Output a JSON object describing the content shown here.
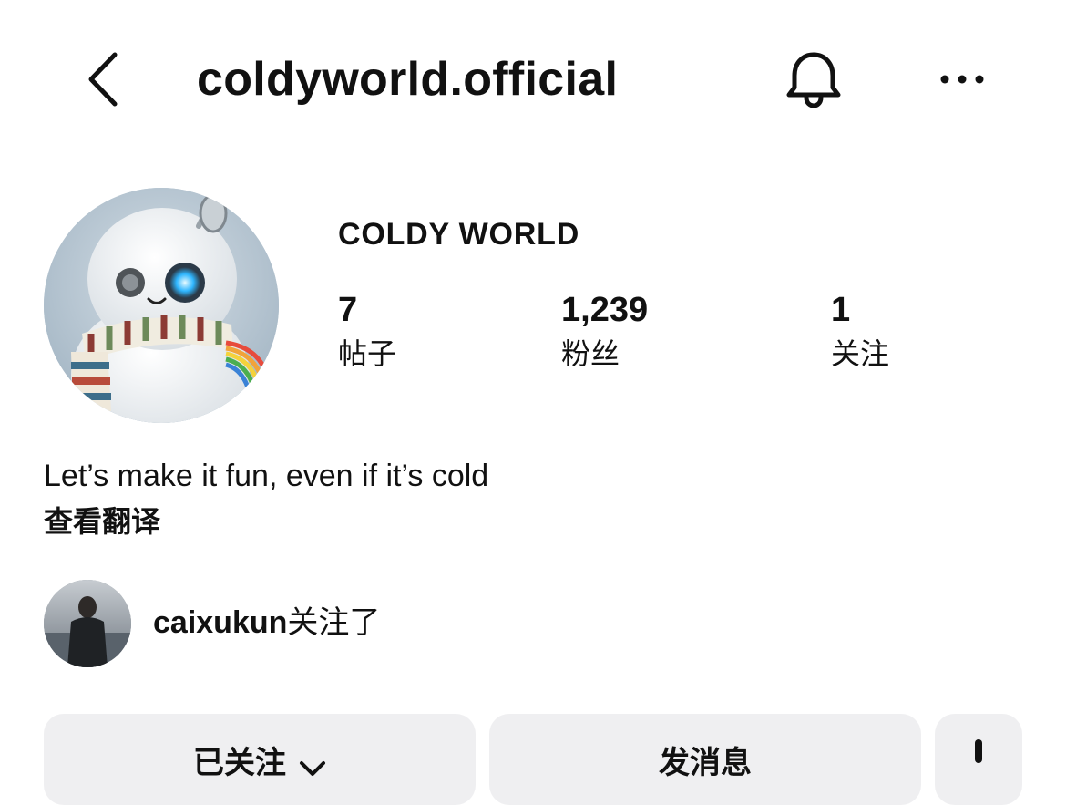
{
  "header": {
    "back_icon": "chevron-left-icon",
    "username": "coldyworld.official",
    "bell_icon": "bell-icon",
    "more_icon": "more-horizontal-icon"
  },
  "profile": {
    "avatar": "snowman-robot-avatar",
    "display_name": "COLDY WORLD",
    "stats": [
      {
        "value": "7",
        "label": "帖子"
      },
      {
        "value": "1,239",
        "label": "粉丝"
      },
      {
        "value": "1",
        "label": "关注"
      }
    ],
    "bio": "Let’s make it fun, even if it’s cold",
    "translate_link": "查看翻译"
  },
  "followed_by": {
    "username": "caixukun",
    "suffix": "关注了"
  },
  "actions": {
    "following_label": "已关注",
    "message_label": "发消息",
    "more_icon": "person-add-icon"
  }
}
